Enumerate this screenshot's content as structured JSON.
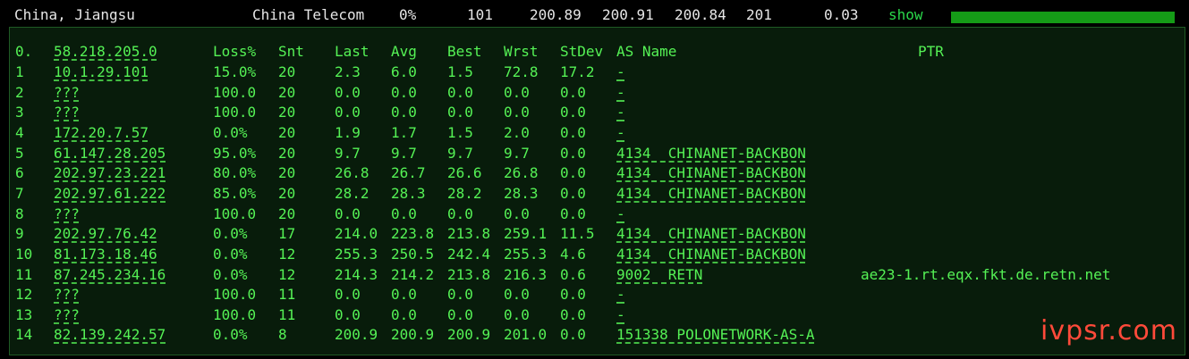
{
  "probe": {
    "location": "China, Jiangsu",
    "isp": "China Telecom",
    "loss": "0%",
    "sent": "101",
    "last": "200.89",
    "avg": "200.91",
    "best": "200.84",
    "worst": "201",
    "stdev": "0.03",
    "show_label": "show",
    "bar_color": "#159c17"
  },
  "table": {
    "headers": {
      "hop": "0.",
      "host": "58.218.205.0",
      "loss": "Loss%",
      "snt": "Snt",
      "last": "Last",
      "avg": "Avg",
      "best": "Best",
      "wrst": "Wrst",
      "stdev": "StDev",
      "as": "AS Name",
      "ptr": "PTR"
    },
    "rows": [
      {
        "hop": "1",
        "host": "10.1.29.101",
        "loss": "15.0%",
        "snt": "20",
        "last": "2.3",
        "avg": "6.0",
        "best": "1.5",
        "wrst": "72.8",
        "stdev": "17.2",
        "as": "-",
        "ptr": ""
      },
      {
        "hop": "2",
        "host": "???",
        "loss": "100.0",
        "snt": "20",
        "last": "0.0",
        "avg": "0.0",
        "best": "0.0",
        "wrst": "0.0",
        "stdev": "0.0",
        "as": "-",
        "ptr": ""
      },
      {
        "hop": "3",
        "host": "???",
        "loss": "100.0",
        "snt": "20",
        "last": "0.0",
        "avg": "0.0",
        "best": "0.0",
        "wrst": "0.0",
        "stdev": "0.0",
        "as": "-",
        "ptr": ""
      },
      {
        "hop": "4",
        "host": "172.20.7.57",
        "loss": "0.0%",
        "snt": "20",
        "last": "1.9",
        "avg": "1.7",
        "best": "1.5",
        "wrst": "2.0",
        "stdev": "0.0",
        "as": "-",
        "ptr": ""
      },
      {
        "hop": "5",
        "host": "61.147.28.205",
        "loss": "95.0%",
        "snt": "20",
        "last": "9.7",
        "avg": "9.7",
        "best": "9.7",
        "wrst": "9.7",
        "stdev": "0.0",
        "as": "4134  CHINANET-BACKBON",
        "ptr": ""
      },
      {
        "hop": "6",
        "host": "202.97.23.221",
        "loss": "80.0%",
        "snt": "20",
        "last": "26.8",
        "avg": "26.7",
        "best": "26.6",
        "wrst": "26.8",
        "stdev": "0.0",
        "as": "4134  CHINANET-BACKBON",
        "ptr": ""
      },
      {
        "hop": "7",
        "host": "202.97.61.222",
        "loss": "85.0%",
        "snt": "20",
        "last": "28.2",
        "avg": "28.3",
        "best": "28.2",
        "wrst": "28.3",
        "stdev": "0.0",
        "as": "4134  CHINANET-BACKBON",
        "ptr": ""
      },
      {
        "hop": "8",
        "host": "???",
        "loss": "100.0",
        "snt": "20",
        "last": "0.0",
        "avg": "0.0",
        "best": "0.0",
        "wrst": "0.0",
        "stdev": "0.0",
        "as": "-",
        "ptr": ""
      },
      {
        "hop": "9",
        "host": "202.97.76.42",
        "loss": "0.0%",
        "snt": "17",
        "last": "214.0",
        "avg": "223.8",
        "best": "213.8",
        "wrst": "259.1",
        "stdev": "11.5",
        "as": "4134  CHINANET-BACKBON",
        "ptr": ""
      },
      {
        "hop": "10",
        "host": "81.173.18.46",
        "loss": "0.0%",
        "snt": "12",
        "last": "255.3",
        "avg": "250.5",
        "best": "242.4",
        "wrst": "255.3",
        "stdev": "4.6",
        "as": "4134  CHINANET-BACKBON",
        "ptr": ""
      },
      {
        "hop": "11",
        "host": "87.245.234.16",
        "loss": "0.0%",
        "snt": "12",
        "last": "214.3",
        "avg": "214.2",
        "best": "213.8",
        "wrst": "216.3",
        "stdev": "0.6",
        "as": "9002  RETN",
        "ptr": "ae23-1.rt.eqx.fkt.de.retn.net"
      },
      {
        "hop": "12",
        "host": "???",
        "loss": "100.0",
        "snt": "11",
        "last": "0.0",
        "avg": "0.0",
        "best": "0.0",
        "wrst": "0.0",
        "stdev": "0.0",
        "as": "-",
        "ptr": ""
      },
      {
        "hop": "13",
        "host": "???",
        "loss": "100.0",
        "snt": "11",
        "last": "0.0",
        "avg": "0.0",
        "best": "0.0",
        "wrst": "0.0",
        "stdev": "0.0",
        "as": "-",
        "ptr": ""
      },
      {
        "hop": "14",
        "host": "82.139.242.57",
        "loss": "0.0%",
        "snt": "8",
        "last": "200.9",
        "avg": "200.9",
        "best": "200.9",
        "wrst": "201.0",
        "stdev": "0.0",
        "as": "151338 POLONETWORK-AS-A",
        "ptr": ""
      }
    ]
  },
  "watermark": "ivpsr.com"
}
